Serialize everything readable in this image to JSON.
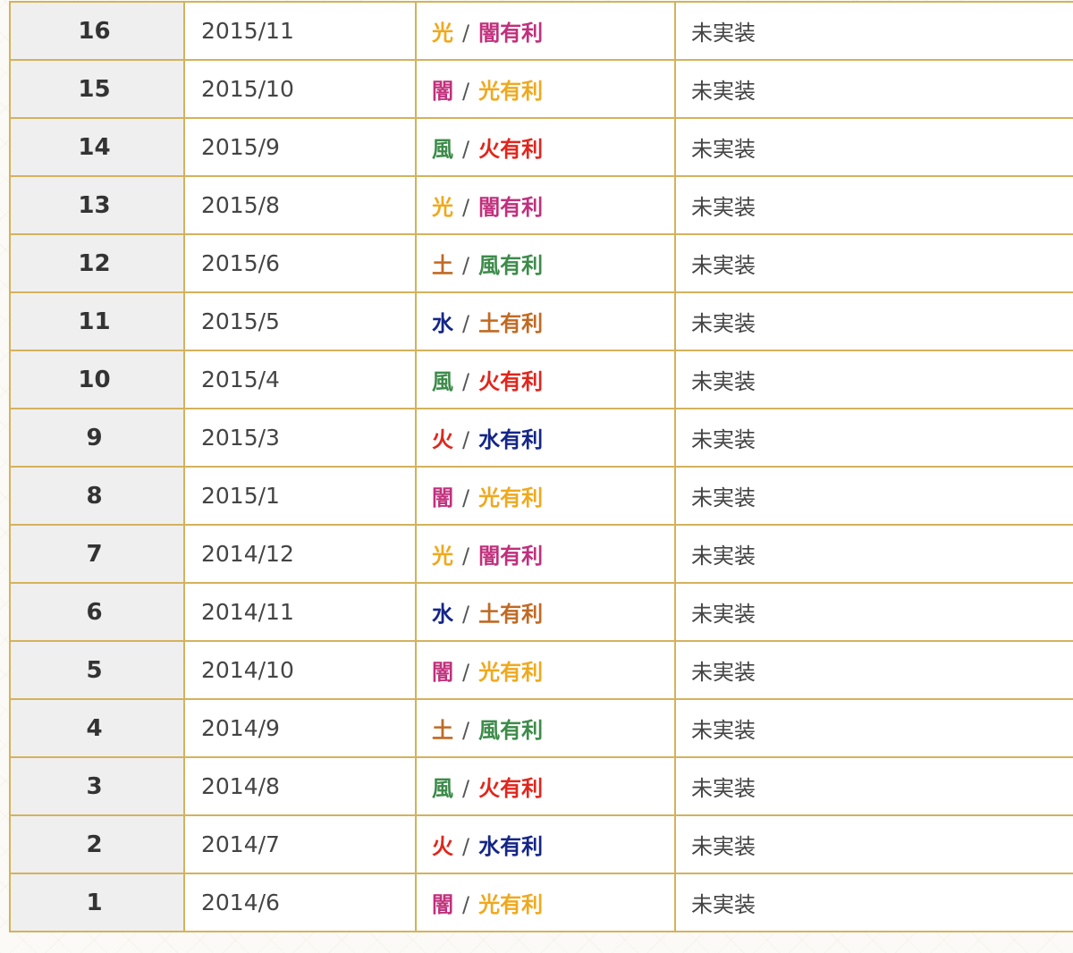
{
  "colors": {
    "光": "#efa91f",
    "闇": "#c0307c",
    "風": "#3d8b4a",
    "火": "#e0261c",
    "土": "#c06a24",
    "水": "#152688",
    "border": "#d4b25c"
  },
  "table": {
    "separator": "/",
    "rows": [
      {
        "no": "16",
        "date": "2015/11",
        "attr": "光",
        "adv": "闇有利",
        "adv_el": "闇",
        "status": "未実装"
      },
      {
        "no": "15",
        "date": "2015/10",
        "attr": "闇",
        "adv": "光有利",
        "adv_el": "光",
        "status": "未実装"
      },
      {
        "no": "14",
        "date": "2015/9",
        "attr": "風",
        "adv": "火有利",
        "adv_el": "火",
        "status": "未実装"
      },
      {
        "no": "13",
        "date": "2015/8",
        "attr": "光",
        "adv": "闇有利",
        "adv_el": "闇",
        "status": "未実装"
      },
      {
        "no": "12",
        "date": "2015/6",
        "attr": "土",
        "adv": "風有利",
        "adv_el": "風",
        "status": "未実装"
      },
      {
        "no": "11",
        "date": "2015/5",
        "attr": "水",
        "adv": "土有利",
        "adv_el": "土",
        "status": "未実装"
      },
      {
        "no": "10",
        "date": "2015/4",
        "attr": "風",
        "adv": "火有利",
        "adv_el": "火",
        "status": "未実装"
      },
      {
        "no": "9",
        "date": "2015/3",
        "attr": "火",
        "adv": "水有利",
        "adv_el": "水",
        "status": "未実装"
      },
      {
        "no": "8",
        "date": "2015/1",
        "attr": "闇",
        "adv": "光有利",
        "adv_el": "光",
        "status": "未実装"
      },
      {
        "no": "7",
        "date": "2014/12",
        "attr": "光",
        "adv": "闇有利",
        "adv_el": "闇",
        "status": "未実装"
      },
      {
        "no": "6",
        "date": "2014/11",
        "attr": "水",
        "adv": "土有利",
        "adv_el": "土",
        "status": "未実装"
      },
      {
        "no": "5",
        "date": "2014/10",
        "attr": "闇",
        "adv": "光有利",
        "adv_el": "光",
        "status": "未実装"
      },
      {
        "no": "4",
        "date": "2014/9",
        "attr": "土",
        "adv": "風有利",
        "adv_el": "風",
        "status": "未実装"
      },
      {
        "no": "3",
        "date": "2014/8",
        "attr": "風",
        "adv": "火有利",
        "adv_el": "火",
        "status": "未実装"
      },
      {
        "no": "2",
        "date": "2014/7",
        "attr": "火",
        "adv": "水有利",
        "adv_el": "水",
        "status": "未実装"
      },
      {
        "no": "1",
        "date": "2014/6",
        "attr": "闇",
        "adv": "光有利",
        "adv_el": "光",
        "status": "未実装"
      }
    ]
  }
}
